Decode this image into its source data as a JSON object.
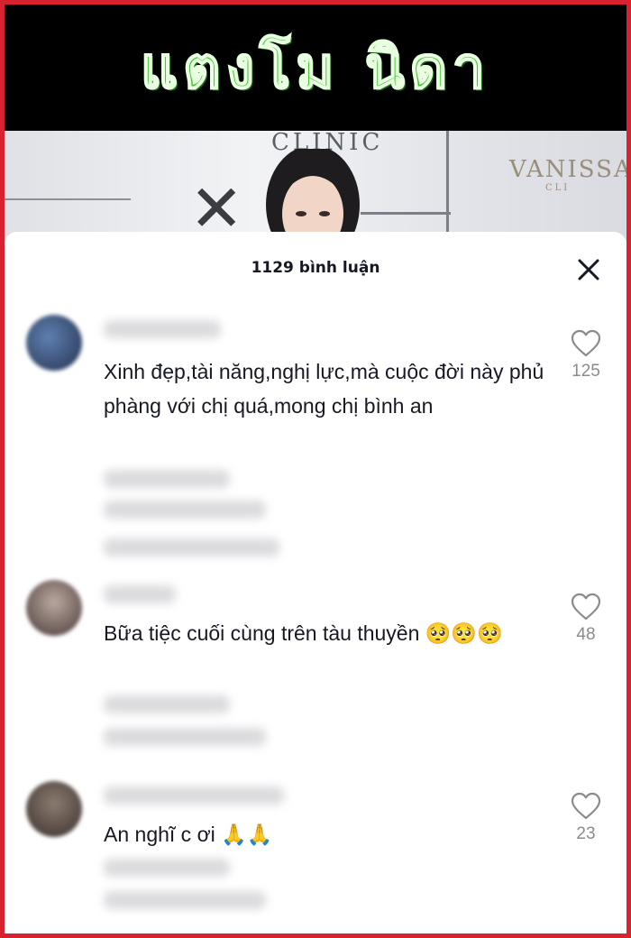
{
  "video": {
    "overlay_title": "แตงโม  นิดา",
    "sign_left": "CLINIC",
    "sign_right": "VANISSA",
    "sign_right_sub": "CLI"
  },
  "comments_panel": {
    "count_label": "1129 bình luận",
    "close_icon": "close-icon"
  },
  "comments": [
    {
      "text": "Xinh đẹp,tài năng,nghị lực,mà cuộc đời này phủ phàng với chị quá,mong chị bình an",
      "likes": "125",
      "like_icon": "heart-outline-icon"
    },
    {
      "text": "Bữa tiệc cuối cùng trên tàu thuyền 🥺🥺🥺",
      "likes": "48",
      "like_icon": "heart-outline-icon"
    },
    {
      "text": "An nghĩ c ơi 🙏🙏",
      "likes": "23",
      "like_icon": "heart-outline-icon"
    }
  ],
  "colors": {
    "frame_border": "#d8222f",
    "title_green": "#3fbf2b",
    "text_primary": "#161823",
    "text_secondary": "#8a8b91"
  }
}
